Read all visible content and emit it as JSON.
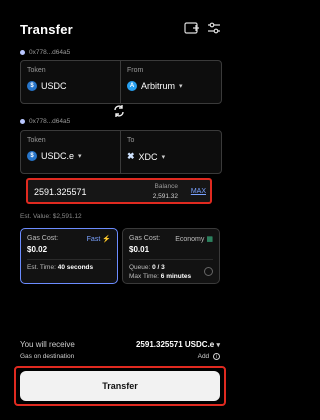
{
  "header": {
    "title": "Transfer"
  },
  "source": {
    "address": "0x778...d64a5",
    "token_label": "Token",
    "token_value": "USDC",
    "from_label": "From",
    "from_value": "Arbitrum"
  },
  "destination": {
    "address": "0x778...d64a5",
    "token_label": "Token",
    "token_value": "USDC.e",
    "to_label": "To",
    "to_value": "XDC"
  },
  "amount": {
    "value": "2591.325571",
    "balance_label": "Balance",
    "balance_value": "2,591.32",
    "max_label": "MAX",
    "est_value": "Est. Value: $2,591.12"
  },
  "gas": {
    "fast": {
      "label": "Gas Cost:",
      "mode": "Fast",
      "cost": "$0.02",
      "line1_label": "Est. Time:",
      "line1_value": "40 seconds"
    },
    "economy": {
      "label": "Gas Cost:",
      "mode": "Economy",
      "cost": "$0.01",
      "line1_label": "Queue:",
      "line1_value": "0 / 3",
      "line2_label": "Max Time:",
      "line2_value": "6 minutes"
    }
  },
  "receive": {
    "label": "You will receive",
    "value": "2591.325571 USDC.e",
    "gas_label": "Gas on destination",
    "gas_action": "Add"
  },
  "action": {
    "transfer_label": "Transfer"
  },
  "colors": {
    "accent": "#7aa2ff",
    "highlight": "#e02a20",
    "usdc": "#2775ca"
  }
}
